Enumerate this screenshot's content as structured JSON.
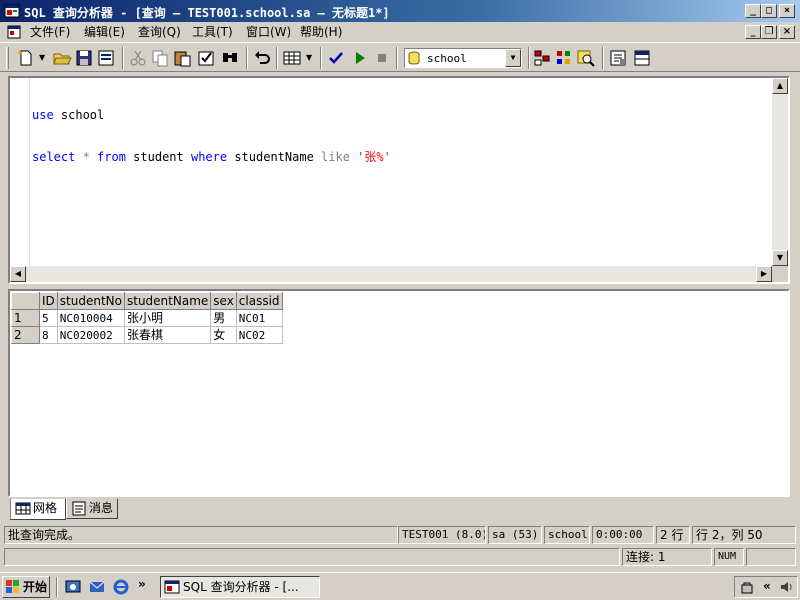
{
  "window": {
    "title": "SQL 查询分析器 - [查询 — TEST001.school.sa — 无标题1*]"
  },
  "menu": {
    "items": [
      "文件(F)",
      "编辑(E)",
      "查询(Q)",
      "工具(T)",
      "窗口(W)",
      "帮助(H)"
    ]
  },
  "toolbar": {
    "database": "school"
  },
  "editor": {
    "line1": {
      "kw": "use",
      "rest": " school"
    },
    "line2": {
      "kw1": "select",
      "star": " * ",
      "kw2": "from",
      "mid": " student ",
      "kw3": "where",
      "col": " studentName ",
      "op": "like",
      "str": " '张%'"
    }
  },
  "results": {
    "columns": [
      "ID",
      "studentNo",
      "studentName",
      "sex",
      "classid"
    ],
    "rows": [
      {
        "num": "1",
        "cells": [
          "5",
          "NC010004",
          "张小明",
          "男",
          "NC01"
        ]
      },
      {
        "num": "2",
        "cells": [
          "8",
          "NC020002",
          "张春棋",
          "女",
          "NC02"
        ]
      }
    ]
  },
  "tabs": {
    "grid": "网格",
    "messages": "消息"
  },
  "status": {
    "message": "批查询完成。",
    "server": "TEST001 (8.0)",
    "user": "sa (53)",
    "db": "school",
    "time": "0:00:00",
    "rows": "2 行",
    "position": "行 2，列 50",
    "connections": "连接: 1",
    "num": "NUM"
  },
  "taskbar": {
    "start": "开始",
    "item": "SQL 查询分析器 - [...",
    "more": "»"
  }
}
